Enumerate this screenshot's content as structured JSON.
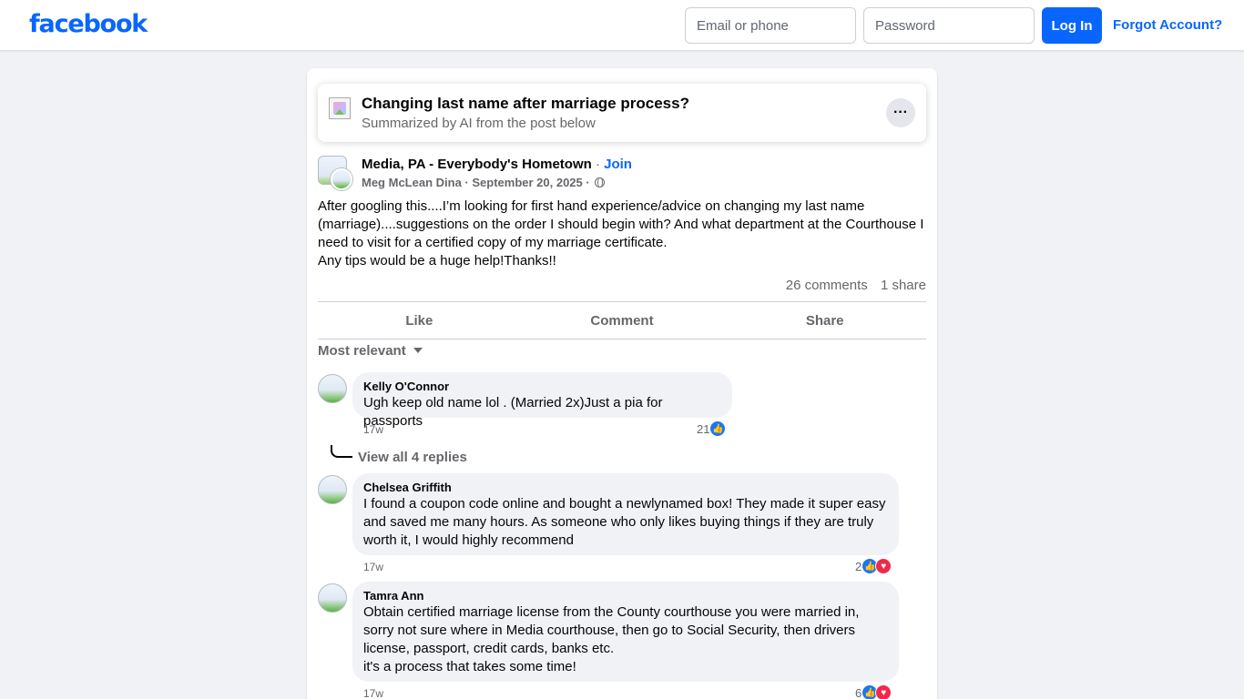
{
  "header": {
    "logo": "facebook",
    "email_placeholder": "Email or phone",
    "password_placeholder": "Password",
    "login_label": "Log In",
    "forgot_label": "Forgot Account?"
  },
  "summary": {
    "title": "Changing last name after marriage process?",
    "subtitle": "Summarized by AI from the post below",
    "more_label": "···"
  },
  "post": {
    "group_name": "Media, PA - Everybody's Hometown",
    "join_label": "Join",
    "author": "Meg McLean Dina",
    "date": "September 20, 2025",
    "text_lines": [
      "After googling this....I’m looking for first hand experience/advice on changing my last name (marriage)....suggestions on the order I should begin with? And what department at the Courthouse I need to visit for a certified copy of my marriage certificate.",
      "Any tips would be a huge help!Thanks!!"
    ],
    "comments_count": "26 comments",
    "shares_count": "1 share",
    "actions": [
      "Like",
      "Comment",
      "Share"
    ]
  },
  "comments_section": {
    "sort_label": "Most relevant",
    "comments": [
      {
        "author": "Kelly O'Connor",
        "text": "Ugh keep old name lol . (Married 2x)Just a pia for passports",
        "time": "17w",
        "reactions": "21",
        "reaction_types": [
          "like-icon"
        ],
        "replies_label": "View all 4 replies"
      },
      {
        "author": "Chelsea Griffith",
        "text": "I found a coupon code online and bought a newlynamed box! They made it super easy and saved me many hours. As someone who only likes buying things if they are truly worth it, I would highly recommend",
        "time": "17w",
        "reactions": "2",
        "reaction_types": [
          "like-icon",
          "love-icon"
        ]
      },
      {
        "author": "Tamra Ann",
        "text_lines": [
          "Obtain certified marriage license from the County courthouse you were married in, sorry not sure where in Media courthouse, then go to Social Security, then drivers license, passport, credit cards, banks etc.",
          "it's a process that takes some time!"
        ],
        "time": "17w",
        "reactions": "6",
        "reaction_types": [
          "like-icon",
          "love-icon"
        ]
      }
    ]
  },
  "colors": {
    "brand": "#0866ff",
    "page_bg": "#f0f2f5",
    "secondary_text": "#65676b",
    "like": "#1877f2",
    "love": "#f02849"
  }
}
